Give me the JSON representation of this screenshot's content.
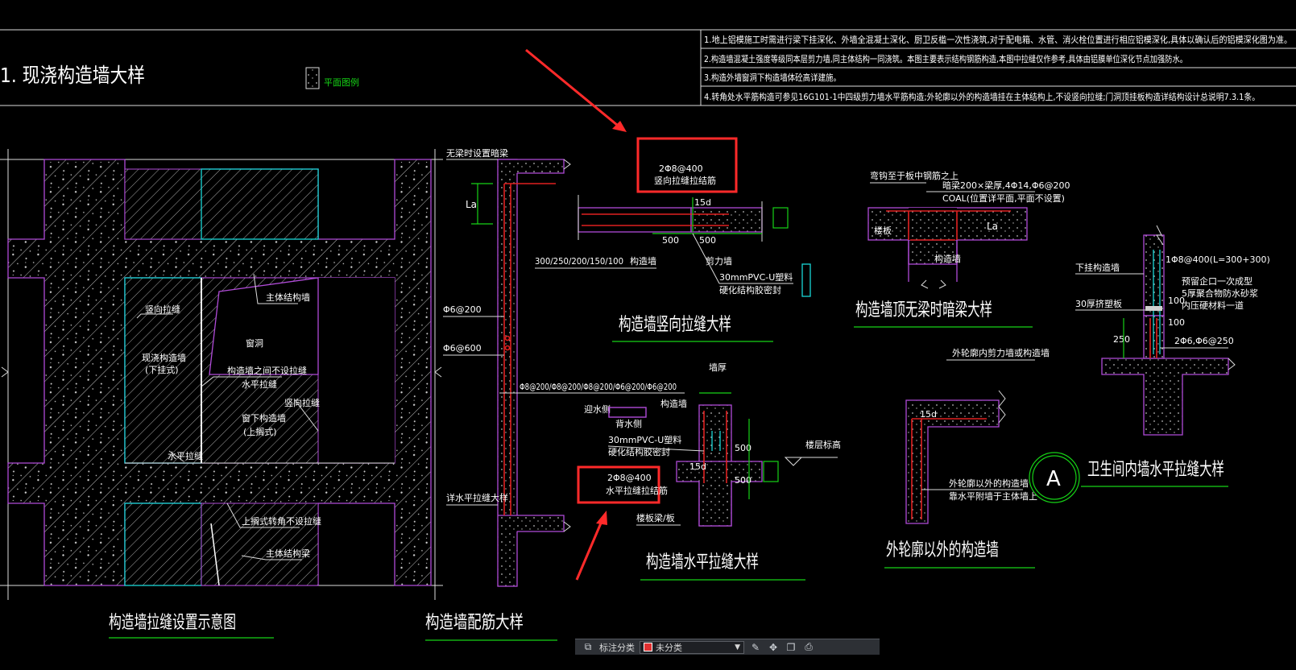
{
  "drawing": {
    "section_title": "1. 现浇构造墙大样",
    "legend_label": "平面图例",
    "notes": [
      "1.地上铝模施工时需进行梁下挂深化、外墙全混凝土深化、厨卫反槛一次性浇筑,对于配电箱、水管、消火栓位置进行相应铝模深化,具体以确认后的铝模深化图为准。",
      "2.构造墙混凝土强度等级同本层剪力墙,同主体结构一同浇筑。本图主要表示结构钢筋构造,本图中拉缝仅作参考,具体由铝膜单位深化节点加强防水。",
      "3.构造外墙窗洞下构造墙体砼高详建施。",
      "4.转角处水平筋构造可参见16G101-1中四级剪力墙水平筋构造;外轮廓以外的构造墙挂在主体结构上,不设竖向拉缝;门洞顶挂板构造详结构设计总说明7.3.1条。"
    ],
    "titles": {
      "layout_schematic": "构造墙拉缝设置示意图",
      "reinforcement": "构造墙配筋大样",
      "vertical_joint": "构造墙竖向拉缝大样",
      "horizontal_joint": "构造墙水平拉缝大样",
      "hidden_beam": "构造墙顶无梁时暗梁大样",
      "outside_outline": "外轮廓以外的构造墙",
      "bathroom_joint": "卫生间内墙水平拉缝大样",
      "circle_tag": "A"
    },
    "labels": {
      "main_structure_wall": "主体结构墙",
      "vertical_joint": "竖向拉缝",
      "structural_wall_lower": "现浇构造墙",
      "lower_hang": "(下挂式)",
      "window": "窗洞",
      "no_joint_between": "构造墙之间不设拉缝",
      "horizontal_joint": "水平拉缝",
      "vertical_joint_2": "竖向拉缝",
      "window_lower_wall": "窗下构造墙",
      "upper_standing": "(上搁式)",
      "horizontal_joint_2": "水平拉缝",
      "upper_no_joint": "上搁式转角不设拉缝",
      "main_structure_beam": "主体结构梁",
      "no_beam_top": "无梁时设置暗梁",
      "la": "La",
      "phi6_200": "Φ6@200",
      "phi6_600": "Φ6@600",
      "rebar_series": "Φ8@200/Φ8@200/Φ8@200/Φ6@200/Φ6@200",
      "see_horizontal": "详水平拉缝大样",
      "rebar_2phi8": "2Φ8@400",
      "anchor_rebar": "竖向拉缝拉结筋",
      "d15": "15d",
      "dim_500a": "500",
      "dim_500b": "500",
      "thickness_list": "300/250/200/150/100",
      "structural_wall_lbl": "构造墙",
      "shear_wall": "剪力墙",
      "pvc_u": "30mmPVC-U塑料",
      "seal": "硬化结构胶密封",
      "dark_beam": "暗梁200×梁厚,4Φ14,Φ6@200",
      "coal": "COAL(位置详平面,平面不设置)",
      "bent_down": "弯钩至于板中钢筋之上",
      "floor_slab": "楼板",
      "structural_wall2": "构造墙",
      "la2": "La",
      "wall_thick": "墙厚",
      "water_side": "迎水侧",
      "back_side": "背水侧",
      "struct_wall3": "构造墙",
      "pvc_u2": "30mmPVC-U塑料",
      "seal2": "硬化结构胶密封",
      "rebar_2phi8b": "2Φ8@400",
      "horiz_anchor": "水平拉缝拉结筋",
      "d15b": "15d",
      "dim_500c": "500",
      "dim_500d": "500",
      "floor_level": "楼层标高",
      "slab_beam": "楼板梁/板",
      "outside_ref": "外轮廓内剪力墙或构造墙",
      "outside_d15": "15d",
      "outside_wall_lbl": "外轮廓以外的构造墙",
      "hang_on_wall": "靠水平附墙于主体墙上",
      "lower_hang_wall": "下挂构造墙",
      "rebar_top": "1Φ8@400(L=300+300)",
      "waterproof1": "预留企口一次成型",
      "waterproof2": "5厚聚合物防水砂浆",
      "waterproof3": "内压硬材料一道",
      "joint30": "30厚挤塑板",
      "dim_100a": "100",
      "dim_100b": "100",
      "dim_250": "250",
      "rebar_bottom": "2Φ6,Φ6@250"
    }
  },
  "toolbar": {
    "label": "标注分类",
    "selected_layer": "未分类",
    "layer_color": "#e03030",
    "icons": [
      "layer-icon",
      "edit-icon",
      "move-icon",
      "copy-icon",
      "save-icon"
    ]
  },
  "colors": {
    "background": "#000000",
    "outline": "#b04bd8",
    "opening": "#18d8d8",
    "dimension": "#16d316",
    "rebar": "#e02020",
    "highlight": "#ff2a2a"
  }
}
